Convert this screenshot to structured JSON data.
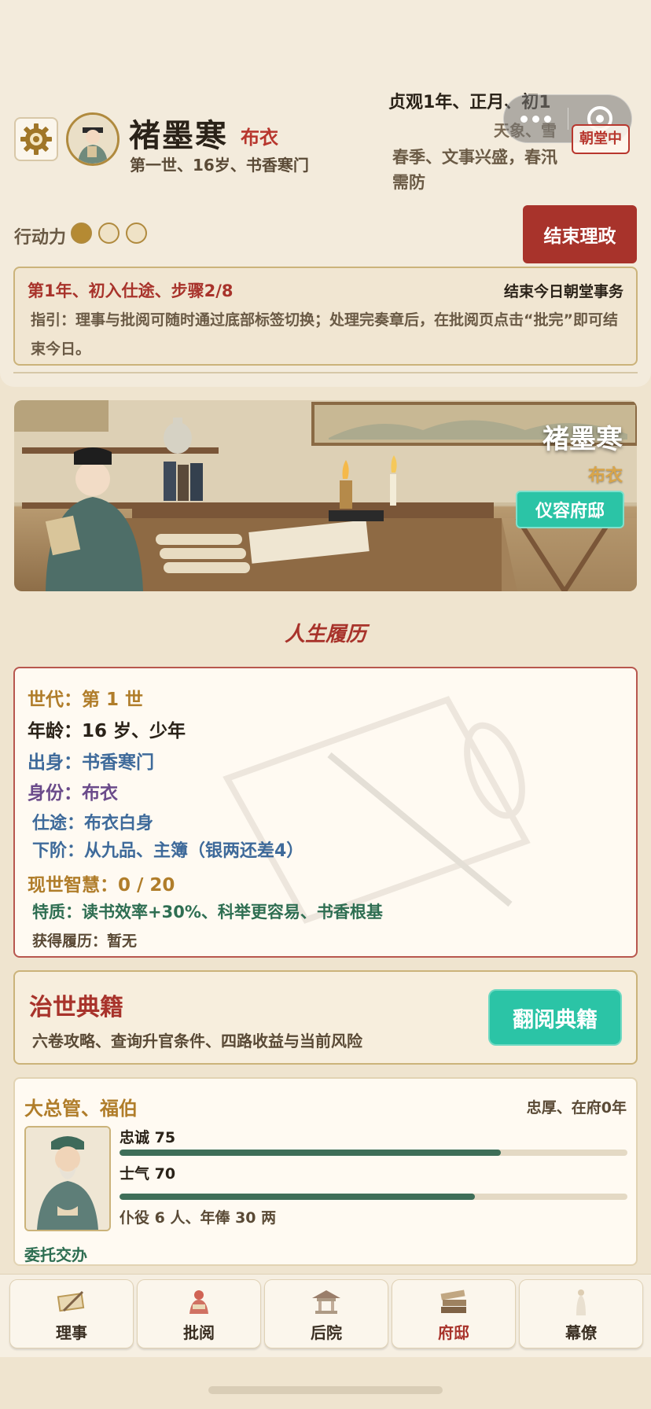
{
  "header": {
    "name": "褚墨寒",
    "rank": "布衣",
    "subtitle": "第一世、16岁、书香寒门",
    "date": "贞观1年、正月、初1",
    "weather": "天象、雪",
    "season": "春季、文事兴盛，春汛需防",
    "court_status": "朝堂中"
  },
  "action_points": {
    "label": "行动力",
    "filled": 1,
    "total": 3
  },
  "end_button": "结束理政",
  "task": {
    "title": "第1年、初入仕途、步骤2/8",
    "right": "结束今日朝堂事务",
    "guide": "指引：理事与批阅可随时通过底部标签切换；处理完奏章后，在批阅页点击“批完”即可结束今日。"
  },
  "scene": {
    "name": "褚墨寒",
    "rank": "布衣",
    "button": "仪容府邸"
  },
  "bio": {
    "section_title": "人生履历",
    "generation": "世代：第 1 世",
    "age": "年龄：16 岁、少年",
    "origin": "出身：书香寒门",
    "identity": "身份：布衣",
    "career": "仕途：布衣白身",
    "next_rank": "下阶：从九品、主簿（银两还差4）",
    "wisdom": "现世智慧：0 / 20",
    "traits": "特质：读书效率+30%、科举更容易、书香根基",
    "records": "获得履历：暂无"
  },
  "classics": {
    "title": "治世典籍",
    "desc": "六卷攻略、查询升官条件、四路收益与当前风险",
    "button": "翻阅典籍"
  },
  "steward": {
    "title": "大总管、福伯",
    "right": "忠厚、在府0年",
    "loyalty_label": "忠诚 75",
    "loyalty": 75,
    "morale_label": "士气 70",
    "morale": 70,
    "staff": "仆役 6 人、年俸 30 两",
    "delegate": "委托交办"
  },
  "tabs": [
    {
      "label": "理事",
      "icon": "scroll-brush-icon",
      "active": false
    },
    {
      "label": "批阅",
      "icon": "reading-official-icon",
      "active": false
    },
    {
      "label": "后院",
      "icon": "pavilion-icon",
      "active": false
    },
    {
      "label": "府邸",
      "icon": "books-icon",
      "active": true
    },
    {
      "label": "幕僚",
      "icon": "advisor-icon",
      "active": false
    }
  ],
  "colors": {
    "accent_red": "#a8332b",
    "accent_teal": "#2bc4a6",
    "gold": "#b07d2a",
    "bar_fill": "#3e6e58"
  }
}
